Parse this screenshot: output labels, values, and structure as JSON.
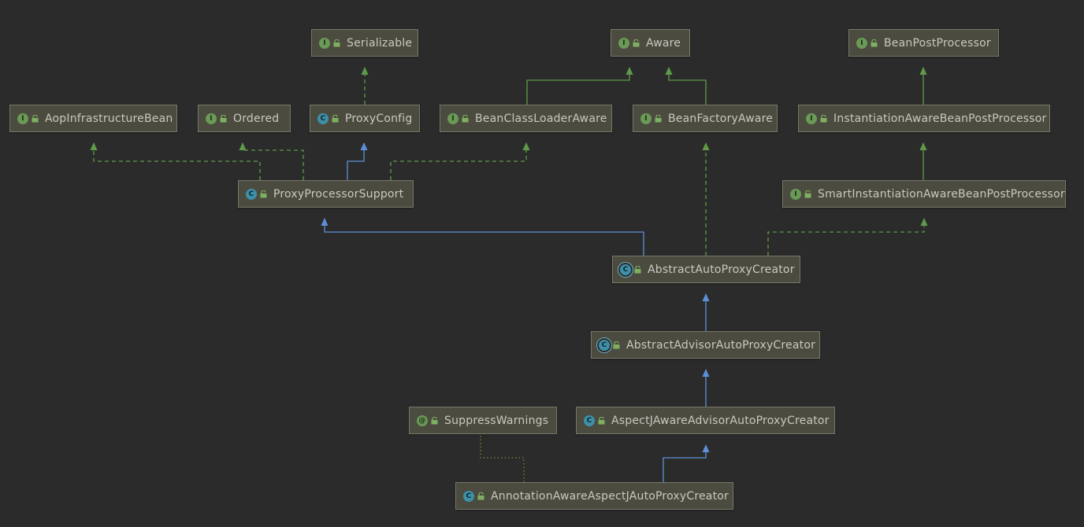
{
  "diagram": {
    "colors": {
      "background": "#2b2b2b",
      "node_fill": "#4b4b40",
      "node_border": "#77776a",
      "implements_edge": "#5e9a48",
      "extends_edge": "#5c8fd6",
      "annotation_edge": "#7a8a3a",
      "interface_icon": "#6a9a55",
      "class_icon": "#3d90a8"
    },
    "nodes": [
      {
        "id": "serializable",
        "label": "Serializable",
        "kind": "interface",
        "kind_glyph": "I",
        "icon": "interface-icon"
      },
      {
        "id": "aware",
        "label": "Aware",
        "kind": "interface",
        "kind_glyph": "I",
        "icon": "interface-icon"
      },
      {
        "id": "beanpostprocessor",
        "label": "BeanPostProcessor",
        "kind": "interface",
        "kind_glyph": "I",
        "icon": "interface-icon"
      },
      {
        "id": "aopinfrastructurebean",
        "label": "AopInfrastructureBean",
        "kind": "interface",
        "kind_glyph": "I",
        "icon": "interface-icon"
      },
      {
        "id": "ordered",
        "label": "Ordered",
        "kind": "interface",
        "kind_glyph": "I",
        "icon": "interface-icon"
      },
      {
        "id": "proxyconfig",
        "label": "ProxyConfig",
        "kind": "class",
        "kind_glyph": "C",
        "icon": "class-icon"
      },
      {
        "id": "beanclassloaderaware",
        "label": "BeanClassLoaderAware",
        "kind": "interface",
        "kind_glyph": "I",
        "icon": "interface-icon"
      },
      {
        "id": "beanfactoryaware",
        "label": "BeanFactoryAware",
        "kind": "interface",
        "kind_glyph": "I",
        "icon": "interface-icon"
      },
      {
        "id": "instantiationawarebeanpostprocessor",
        "label": "InstantiationAwareBeanPostProcessor",
        "kind": "interface",
        "kind_glyph": "I",
        "icon": "interface-icon"
      },
      {
        "id": "proxyprocessorsupport",
        "label": "ProxyProcessorSupport",
        "kind": "class",
        "kind_glyph": "C",
        "icon": "class-icon"
      },
      {
        "id": "smartinstantiationawarebeanpostprocessor",
        "label": "SmartInstantiationAwareBeanPostProcessor",
        "kind": "interface",
        "kind_glyph": "I",
        "icon": "interface-icon"
      },
      {
        "id": "abstractautoproxycreator",
        "label": "AbstractAutoProxyCreator",
        "kind": "abstract",
        "kind_glyph": "C",
        "icon": "abstract-class-icon"
      },
      {
        "id": "abstractadvisorautoproxycreator",
        "label": "AbstractAdvisorAutoProxyCreator",
        "kind": "abstract",
        "kind_glyph": "C",
        "icon": "abstract-class-icon"
      },
      {
        "id": "suppresswarnings",
        "label": "SuppressWarnings",
        "kind": "annotation",
        "kind_glyph": "@",
        "icon": "annotation-icon"
      },
      {
        "id": "aspectjawareadvisorautoproxycreator",
        "label": "AspectJAwareAdvisorAutoProxyCreator",
        "kind": "class",
        "kind_glyph": "C",
        "icon": "class-icon"
      },
      {
        "id": "annotationawareaspectjautoproxycreator",
        "label": "AnnotationAwareAspectJAutoProxyCreator",
        "kind": "class",
        "kind_glyph": "C",
        "icon": "class-icon"
      }
    ],
    "edges": [
      {
        "from": "proxyconfig",
        "to": "serializable",
        "type": "implements"
      },
      {
        "from": "beanclassloaderaware",
        "to": "aware",
        "type": "extends-interface"
      },
      {
        "from": "beanfactoryaware",
        "to": "aware",
        "type": "extends-interface"
      },
      {
        "from": "instantiationawarebeanpostprocessor",
        "to": "beanpostprocessor",
        "type": "extends-interface"
      },
      {
        "from": "smartinstantiationawarebeanpostprocessor",
        "to": "instantiationawarebeanpostprocessor",
        "type": "extends-interface"
      },
      {
        "from": "proxyprocessorsupport",
        "to": "aopinfrastructurebean",
        "type": "implements"
      },
      {
        "from": "proxyprocessorsupport",
        "to": "ordered",
        "type": "implements"
      },
      {
        "from": "proxyprocessorsupport",
        "to": "proxyconfig",
        "type": "extends"
      },
      {
        "from": "proxyprocessorsupport",
        "to": "beanclassloaderaware",
        "type": "implements"
      },
      {
        "from": "abstractautoproxycreator",
        "to": "proxyprocessorsupport",
        "type": "extends"
      },
      {
        "from": "abstractautoproxycreator",
        "to": "beanfactoryaware",
        "type": "implements"
      },
      {
        "from": "abstractautoproxycreator",
        "to": "smartinstantiationawarebeanpostprocessor",
        "type": "implements"
      },
      {
        "from": "abstractadvisorautoproxycreator",
        "to": "abstractautoproxycreator",
        "type": "extends"
      },
      {
        "from": "aspectjawareadvisorautoproxycreator",
        "to": "abstractadvisorautoproxycreator",
        "type": "extends"
      },
      {
        "from": "annotationawareaspectjautoproxycreator",
        "to": "aspectjawareadvisorautoproxycreator",
        "type": "extends"
      },
      {
        "from": "annotationawareaspectjautoproxycreator",
        "to": "suppresswarnings",
        "type": "annotated-by"
      }
    ]
  }
}
